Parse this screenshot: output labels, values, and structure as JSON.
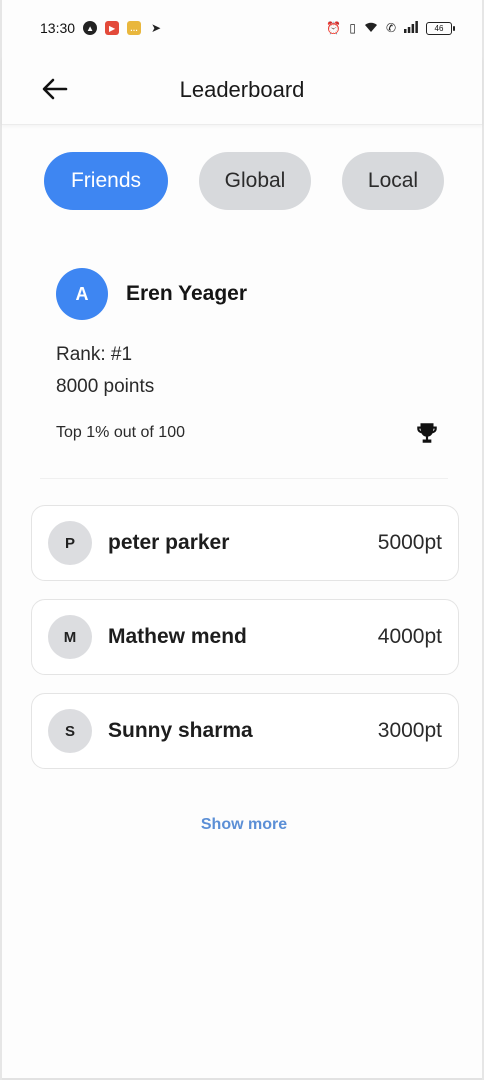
{
  "status_bar": {
    "time": "13:30",
    "notification_icons": [
      "maps-icon",
      "youtube-icon",
      "chat-icon",
      "telegram-icon"
    ],
    "system_icons": [
      "alarm-icon",
      "vibrate-icon",
      "wifi-icon",
      "call-icon",
      "signal-icon"
    ],
    "battery": "46"
  },
  "app_bar": {
    "title": "Leaderboard",
    "back_icon": "back-arrow-icon"
  },
  "tabs": [
    {
      "label": "Friends",
      "active": true
    },
    {
      "label": "Global",
      "active": false
    },
    {
      "label": "Local",
      "active": false
    }
  ],
  "me": {
    "initial": "A",
    "name": "Eren Yeager",
    "rank": "Rank: #1",
    "points": "8000 points",
    "percentile": "Top 1% out of 100",
    "badge_icon": "trophy-icon"
  },
  "leaders": [
    {
      "initial": "P",
      "name": "peter parker",
      "points": "5000pt"
    },
    {
      "initial": "M",
      "name": "Mathew mend",
      "points": "4000pt"
    },
    {
      "initial": "S",
      "name": "Sunny sharma",
      "points": "3000pt"
    }
  ],
  "show_more": "Show more",
  "colors": {
    "accent": "#3e86f2",
    "tab_inactive": "#d7d9dc",
    "link": "#5b8fd6"
  }
}
